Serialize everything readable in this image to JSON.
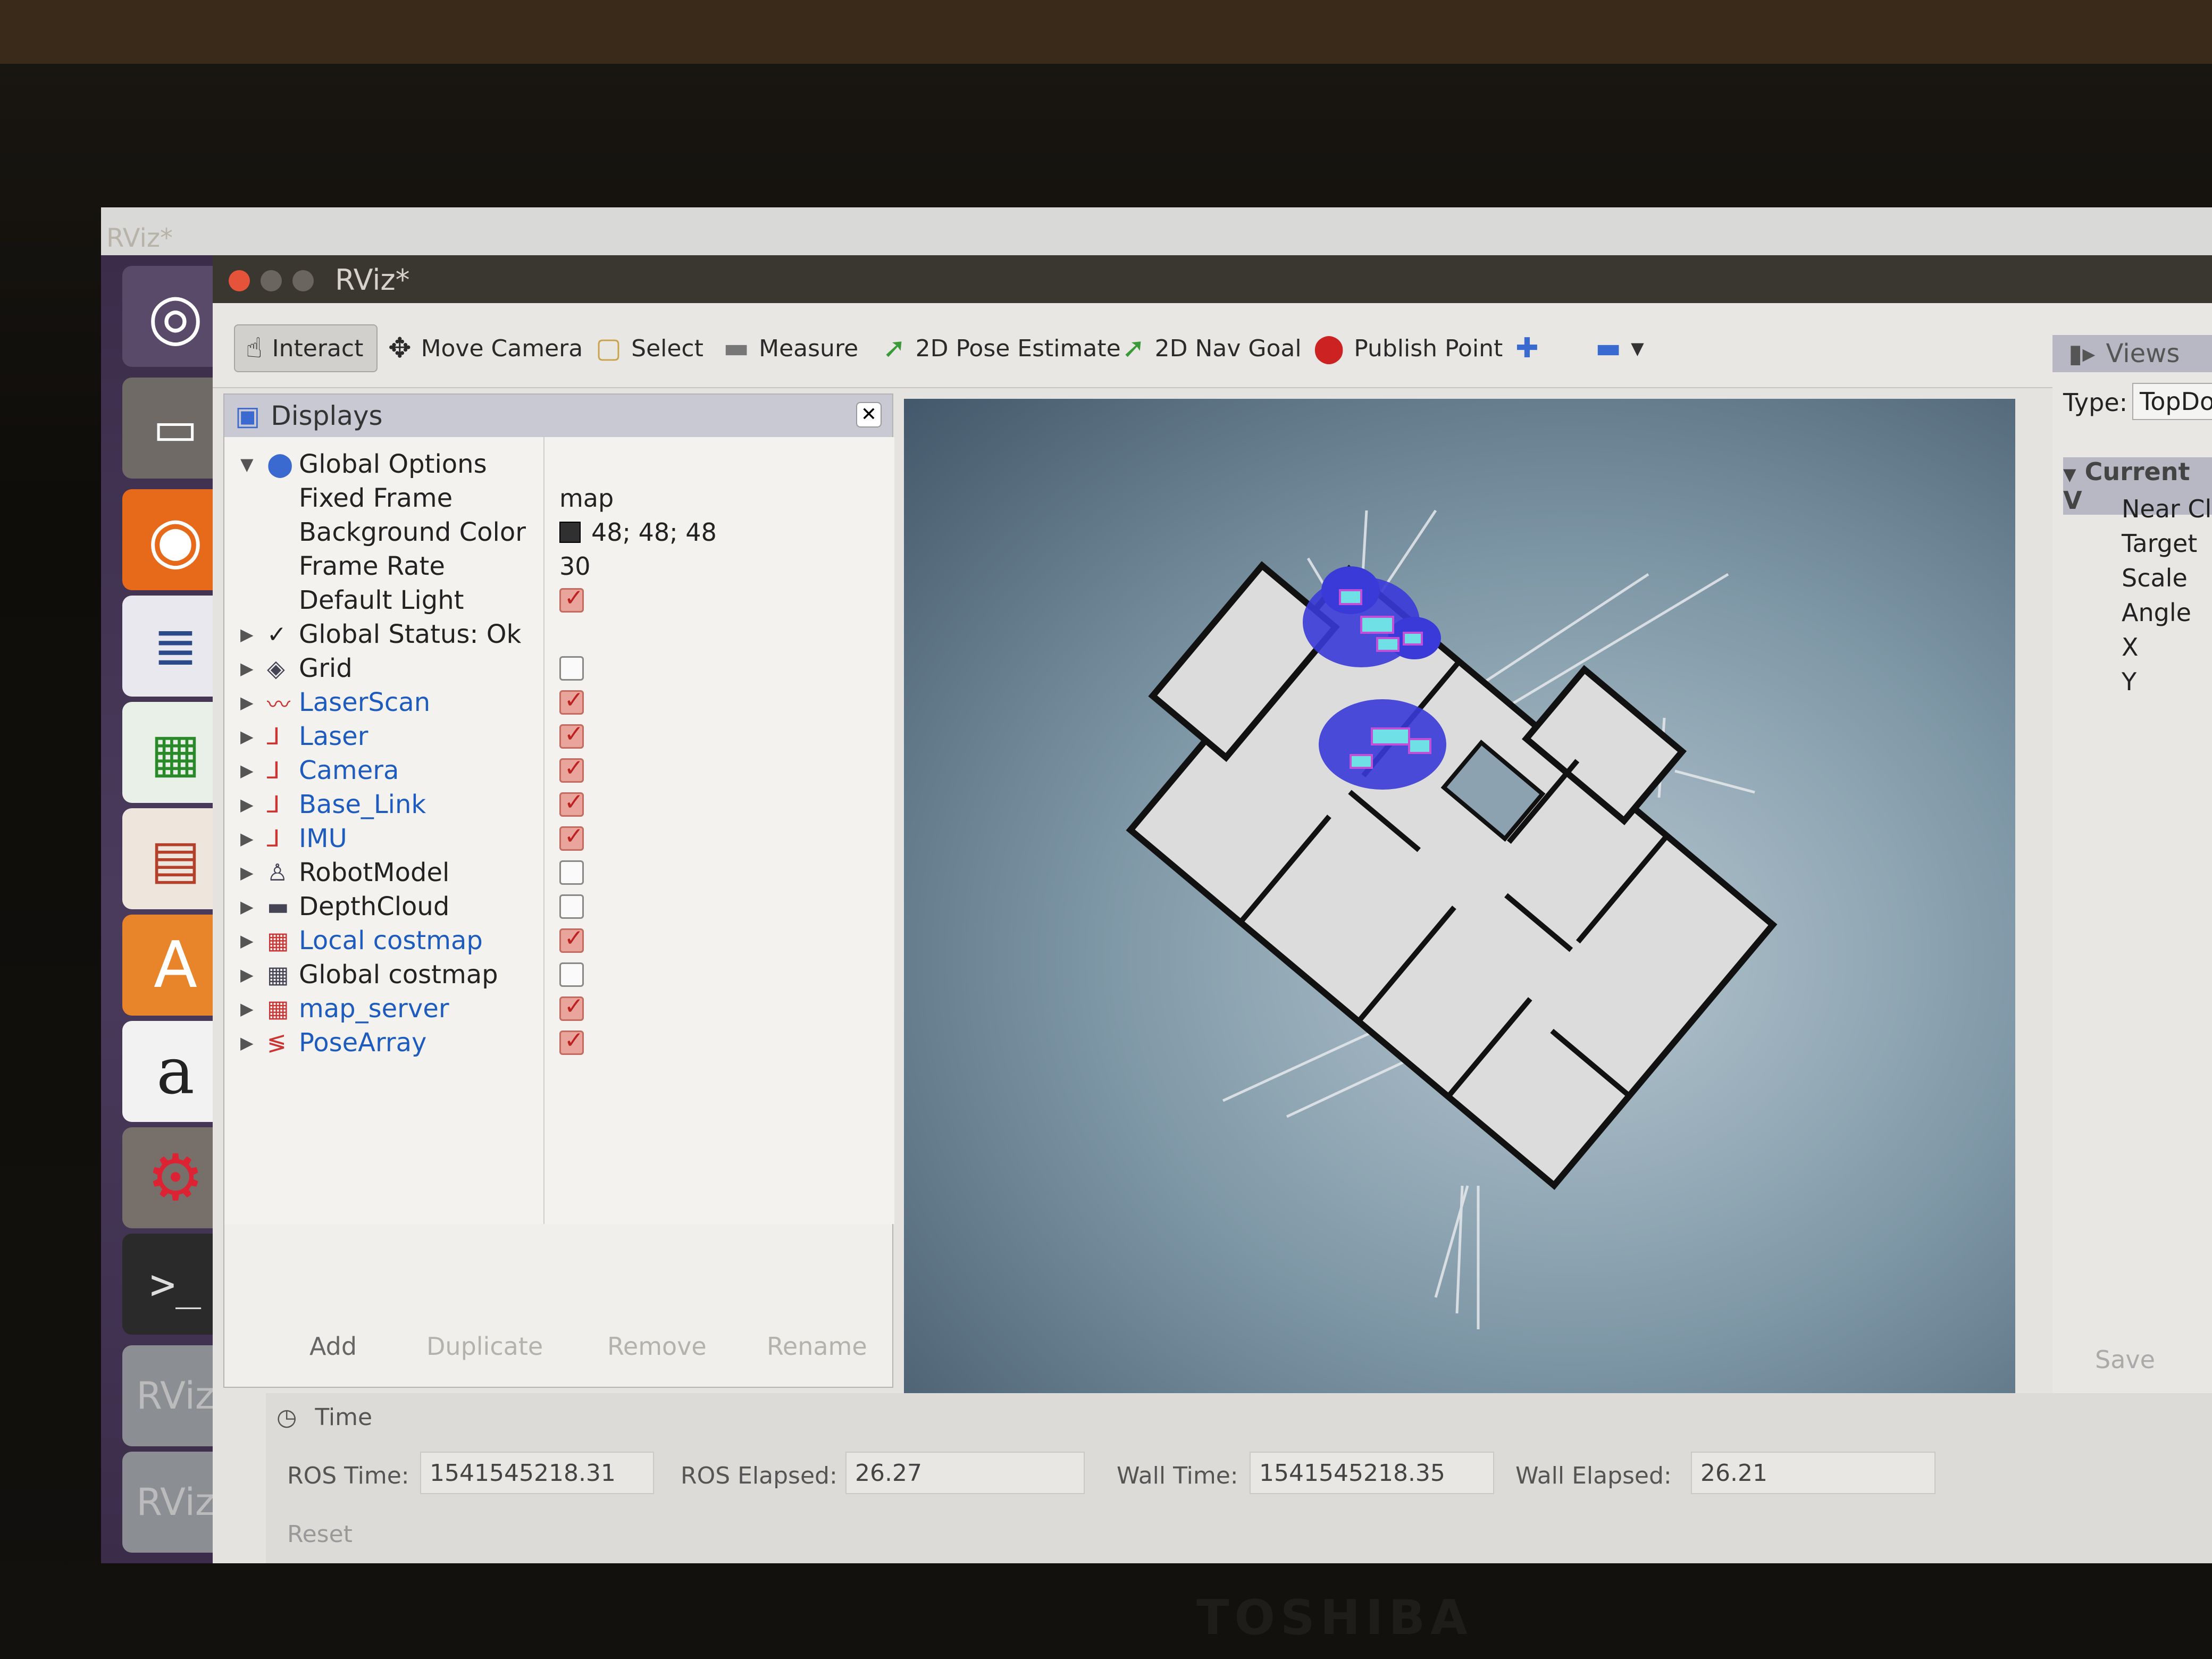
{
  "unity_title": "RViz*",
  "window": {
    "title": "RViz*"
  },
  "toolbar": {
    "interact": "Interact",
    "move_camera": "Move Camera",
    "select": "Select",
    "measure": "Measure",
    "pose_estimate": "2D Pose Estimate",
    "nav_goal": "2D Nav Goal",
    "publish_point": "Publish Point"
  },
  "displays": {
    "title": "Displays",
    "global_options": "Global Options",
    "fixed_frame_label": "Fixed Frame",
    "fixed_frame_value": "map",
    "background_color_label": "Background Color",
    "background_color_value": "48; 48; 48",
    "background_color_swatch": "#303030",
    "frame_rate_label": "Frame Rate",
    "frame_rate_value": "30",
    "default_light_label": "Default Light",
    "global_status": "Global Status: Ok",
    "items": [
      {
        "label": "Grid",
        "checked": false,
        "blue": false
      },
      {
        "label": "LaserScan",
        "checked": true,
        "blue": true
      },
      {
        "label": "Laser",
        "checked": true,
        "blue": true
      },
      {
        "label": "Camera",
        "checked": true,
        "blue": true
      },
      {
        "label": "Base_Link",
        "checked": true,
        "blue": true
      },
      {
        "label": "IMU",
        "checked": true,
        "blue": true
      },
      {
        "label": "RobotModel",
        "checked": false,
        "blue": false
      },
      {
        "label": "DepthCloud",
        "checked": false,
        "blue": false
      },
      {
        "label": "Local costmap",
        "checked": true,
        "blue": true
      },
      {
        "label": "Global costmap",
        "checked": false,
        "blue": false
      },
      {
        "label": "map_server",
        "checked": true,
        "blue": true
      },
      {
        "label": "PoseArray",
        "checked": true,
        "blue": true
      }
    ],
    "buttons": {
      "add": "Add",
      "duplicate": "Duplicate",
      "remove": "Remove",
      "rename": "Rename"
    }
  },
  "views": {
    "title": "Views",
    "type_label": "Type:",
    "type_value": "TopDo",
    "current_view": "Current V",
    "rows": [
      "Near Cl",
      "Target",
      "Scale",
      "Angle",
      "X",
      "Y"
    ],
    "save": "Save"
  },
  "time": {
    "title": "Time",
    "ros_time_label": "ROS Time:",
    "ros_time_value": "1541545218.31",
    "ros_elapsed_label": "ROS Elapsed:",
    "ros_elapsed_value": "26.27",
    "wall_time_label": "Wall Time:",
    "wall_time_value": "1541545218.35",
    "wall_elapsed_label": "Wall Elapsed:",
    "wall_elapsed_value": "26.21",
    "reset": "Reset"
  },
  "bezel_brand": "TOSHIBA"
}
